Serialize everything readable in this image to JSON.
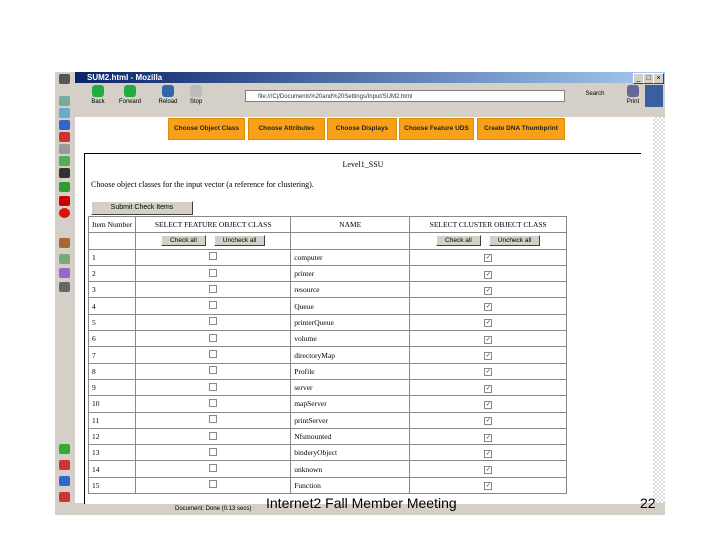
{
  "window": {
    "title": "SUM2.html - Mozilla",
    "controls": [
      "_",
      "□",
      "×"
    ]
  },
  "toolbar": {
    "back": "Back",
    "forward": "Forward",
    "reload": "Reload",
    "stop": "Stop",
    "url": "file:///C|/Documents%20and%20Settings/Input/SUM2.html",
    "search": "Search",
    "print": "Print"
  },
  "nav_tabs": [
    "Choose Object Class",
    "Choose Attributes",
    "Choose Displays",
    "Choose Feature UDS",
    "Create DNA Thumbprint"
  ],
  "page": {
    "title": "Level1_SSU",
    "instruction": "Choose object classes for the input vector (a reference for clustering).",
    "submit": "Submit Check Items"
  },
  "table": {
    "headers": [
      "Item Number",
      "SELECT FEATURE OBJECT CLASS",
      "NAME",
      "SELECT CLUSTER OBJECT CLASS"
    ],
    "feature_buttons": [
      "Check all",
      "Uncheck all"
    ],
    "cluster_buttons": [
      "Check all",
      "Uncheck all"
    ],
    "rows": [
      {
        "n": "1",
        "name": "computer",
        "feature": false,
        "cluster": true
      },
      {
        "n": "2",
        "name": "printer",
        "feature": false,
        "cluster": true
      },
      {
        "n": "3",
        "name": "resource",
        "feature": false,
        "cluster": true
      },
      {
        "n": "4",
        "name": "Queue",
        "feature": false,
        "cluster": true
      },
      {
        "n": "5",
        "name": "printerQueue",
        "feature": false,
        "cluster": true
      },
      {
        "n": "6",
        "name": "volume",
        "feature": false,
        "cluster": true
      },
      {
        "n": "7",
        "name": "directoryMap",
        "feature": false,
        "cluster": true
      },
      {
        "n": "8",
        "name": "Profile",
        "feature": false,
        "cluster": true
      },
      {
        "n": "9",
        "name": "server",
        "feature": false,
        "cluster": true
      },
      {
        "n": "10",
        "name": "mapServer",
        "feature": false,
        "cluster": true
      },
      {
        "n": "11",
        "name": "printServer",
        "feature": false,
        "cluster": true
      },
      {
        "n": "12",
        "name": "Nfsmounted",
        "feature": false,
        "cluster": true
      },
      {
        "n": "13",
        "name": "binderyObject",
        "feature": false,
        "cluster": true
      },
      {
        "n": "14",
        "name": "unknown",
        "feature": false,
        "cluster": true
      },
      {
        "n": "15",
        "name": "Function",
        "feature": false,
        "cluster": true
      }
    ]
  },
  "status": {
    "text": "Document: Done (0.13 secs)"
  },
  "slide": {
    "footer": "Internet2 Fall Member Meeting",
    "page_number": "22"
  },
  "colors": {
    "tab": "#f7a11a",
    "titlebar": "#0a246a"
  }
}
